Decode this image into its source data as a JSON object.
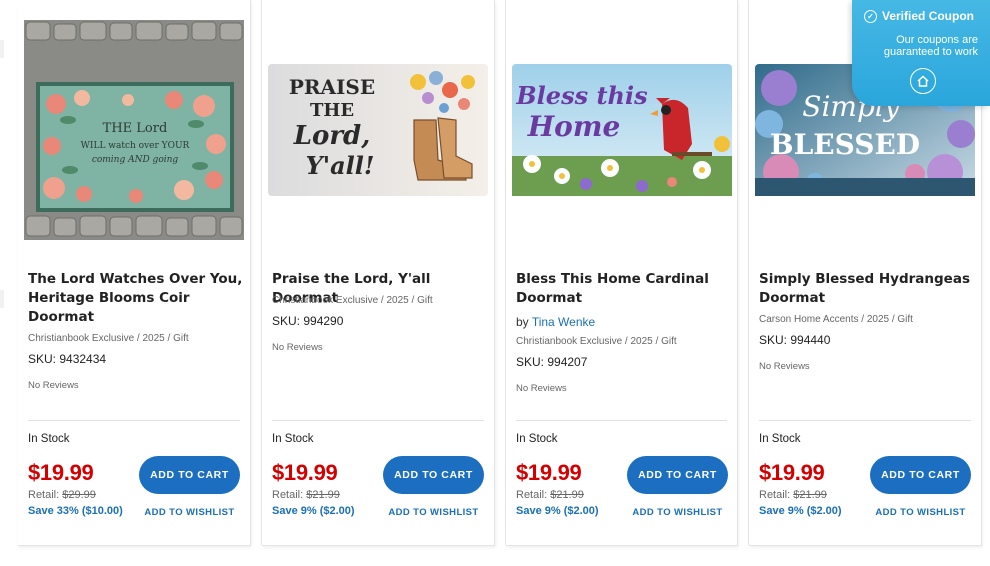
{
  "coupon": {
    "title": "Verified Coupon",
    "subtitle_line1": "Our coupons are",
    "subtitle_line2": "guaranteed to work",
    "accent": "#2aa6dc"
  },
  "colors": {
    "price": "#d40000",
    "brand_blue": "#1c6fc0",
    "link_blue": "#1a6fb5"
  },
  "products": [
    {
      "title": "The Lord Watches Over You, Heritage Blooms Coir Doormat",
      "author_prefix": "",
      "author": "",
      "exclusive": "Christianbook Exclusive / 2025 / Gift",
      "sku": "SKU: 9432434",
      "reviews": "No Reviews",
      "stock": "In Stock",
      "price": "$19.99",
      "retail_label": "Retail:",
      "retail": "$29.99",
      "save": "Save 33% ($10.00)",
      "cart_label": "ADD TO CART",
      "wishlist_label": "ADD TO WISHLIST",
      "image_text_line1": "THE Lord",
      "image_text_line2": "WILL watch over YOUR",
      "image_text_line3": "coming AND going"
    },
    {
      "title": "Praise the Lord, Y'all Doormat",
      "author_prefix": "",
      "author": "",
      "exclusive": "Christianbook Exclusive / 2025 / Gift",
      "sku": "SKU: 994290",
      "reviews": "No Reviews",
      "stock": "In Stock",
      "price": "$19.99",
      "retail_label": "Retail:",
      "retail": "$21.99",
      "save": "Save 9% ($2.00)",
      "cart_label": "ADD TO CART",
      "wishlist_label": "ADD TO WISHLIST",
      "image_text_line1": "PRAISE",
      "image_text_line2": "THE",
      "image_text_line3": "Lord,",
      "image_text_line4": "Y'all!"
    },
    {
      "title": "Bless This Home Cardinal Doormat",
      "author_prefix": "by",
      "author": "Tina Wenke",
      "exclusive": "Christianbook Exclusive / 2025 / Gift",
      "sku": "SKU: 994207",
      "reviews": "No Reviews",
      "stock": "In Stock",
      "price": "$19.99",
      "retail_label": "Retail:",
      "retail": "$21.99",
      "save": "Save 9% ($2.00)",
      "cart_label": "ADD TO CART",
      "wishlist_label": "ADD TO WISHLIST",
      "image_text_line1": "Bless this",
      "image_text_line2": "Home"
    },
    {
      "title": "Simply Blessed Hydrangeas Doormat",
      "author_prefix": "",
      "author": "",
      "exclusive": "Carson Home Accents / 2025 / Gift",
      "sku": "SKU: 994440",
      "reviews": "No Reviews",
      "stock": "In Stock",
      "price": "$19.99",
      "retail_label": "Retail:",
      "retail": "$21.99",
      "save": "Save 9% ($2.00)",
      "cart_label": "ADD TO CART",
      "wishlist_label": "ADD TO WISHLIST",
      "image_text_line1": "Simply",
      "image_text_line2": "BLESSED"
    }
  ]
}
